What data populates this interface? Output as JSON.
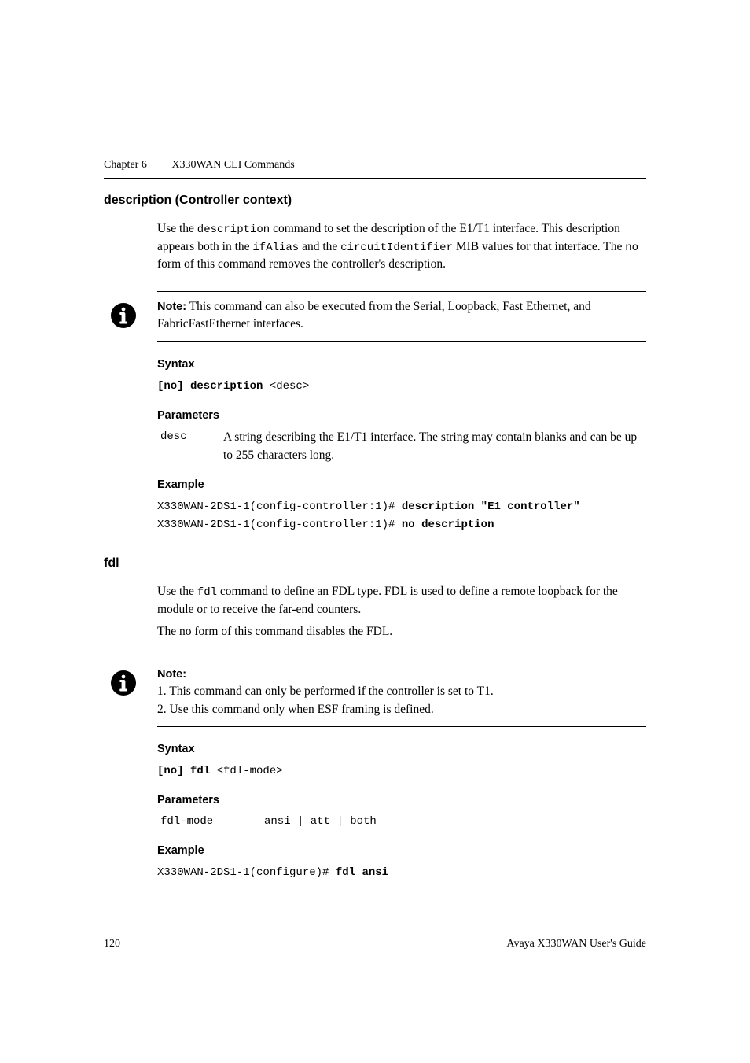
{
  "running_head": {
    "chapter": "Chapter 6",
    "title": "X330WAN CLI Commands"
  },
  "section1": {
    "title": "description (Controller context)",
    "intro_html": "Use the <code>description</code> command to set the description of the E1/T1 interface. This description appears both in the <code>ifAlias</code> and the <code>circuitIdentifier</code> MIB values for that interface. The <code>no</code> form of this command removes the controller's description.",
    "note_label": "Note:",
    "note_text": "This command can also be executed from the Serial, Loopback, Fast Ethernet, and FabricFastEthernet interfaces.",
    "syntax_label": "Syntax",
    "syntax_line_html": "<span class=\"code-bold\">[no] description</span> &lt;desc&gt;",
    "params_label": "Parameters",
    "param_key": "desc",
    "param_desc": "A string describing the E1/T1 interface. The string may contain blanks and can be up to 255 characters long.",
    "example_label": "Example",
    "example_line1_html": "X330WAN-2DS1-1(config-controller:1)# <span class=\"code-bold\">description \"E1 controller\"</span>",
    "example_line2_html": "X330WAN-2DS1-1(config-controller:1)# <span class=\"code-bold\">no description</span>"
  },
  "section2": {
    "title": "fdl",
    "intro1_html": "Use the <code>fdl</code> command to define an FDL type. FDL is used to define a remote loopback for the module or to receive the far-end counters.",
    "intro2": "The no form of this command disables the FDL.",
    "note_label": "Note:",
    "note_item1": "1.  This command can only be performed if the controller is set to T1.",
    "note_item2": "2.  Use this command only when ESF framing is defined.",
    "syntax_label": "Syntax",
    "syntax_line_html": "<span class=\"code-bold\">[no] fdl</span> &lt;fdl-mode&gt;",
    "params_label": "Parameters",
    "param_key": "fdl-mode",
    "param_desc": "ansi | att | both",
    "example_label": "Example",
    "example_line_html": "X330WAN-2DS1-1(configure)# <span class=\"code-bold\">fdl ansi</span>"
  },
  "footer": {
    "page": "120",
    "book": "Avaya X330WAN User's Guide"
  },
  "icons": {
    "info": "info-icon"
  }
}
